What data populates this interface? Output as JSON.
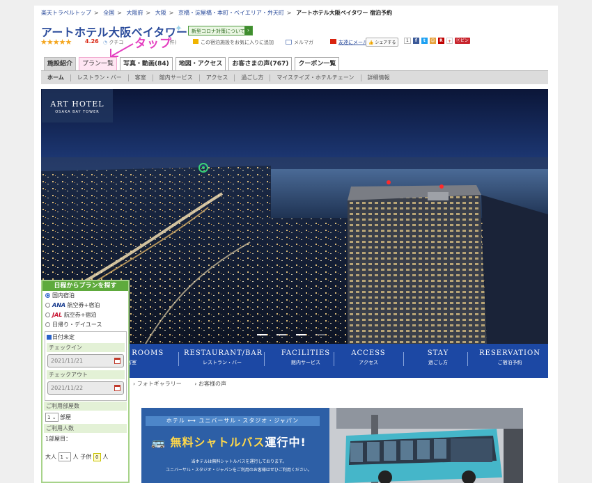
{
  "breadcrumb": [
    "楽天トラベルトップ",
    "全国",
    "大阪府",
    "大阪",
    "京橋・淀屋橋・本町・ベイエリア・弁天町",
    "アートホテル大阪ベイタワー 宿泊予約"
  ],
  "breadcrumb_sep": ">",
  "hotel": {
    "name": "アートホテル大阪ベイタワー",
    "covid_button": "新型コロナ対策について",
    "rating_stars": 4.26,
    "rating": "4.26",
    "kuchikomi": "クチコ",
    "kuchikomi_tail": "件)",
    "favorite": "この宿泊施設をお気に入りに追加",
    "mailmag": "メルマガ",
    "tell_friend": "友達にメール",
    "share": "シェアする",
    "share_count": "1",
    "pin": "ピン"
  },
  "annotation": {
    "text": "タップ",
    "color": "#e43ec0"
  },
  "tabs": [
    "施設紹介",
    "プラン一覧",
    "写真・動画(84)",
    "地図・アクセス",
    "お客さまの声(767)",
    "クーポン一覧"
  ],
  "subnav": [
    "ホーム",
    "レストラン・バー",
    "客室",
    "館内サービス",
    "アクセス",
    "過ごし方",
    "マイステイズ・ホテルチェーン",
    "詳細情報"
  ],
  "hero": {
    "logo_main": "ART HOTEL",
    "logo_sub": "OSAKA BAY TOWER"
  },
  "banner_nav": [
    {
      "en": "GUEST ROOMS",
      "jp": "客室"
    },
    {
      "en": "RESTAURANT/BAR",
      "jp": "レストラン・バー"
    },
    {
      "en": "FACILITIES",
      "jp": "館内サービス"
    },
    {
      "en": "ACCESS",
      "jp": "アクセス"
    },
    {
      "en": "STAY",
      "jp": "過ごし方"
    },
    {
      "en": "RESERVATION",
      "jp": "ご宿泊予約"
    }
  ],
  "links": [
    "フォトギャラリー",
    "お客様の声"
  ],
  "search": {
    "title": "日程からプランを探す",
    "options": [
      {
        "label": "国内宿泊",
        "brand": "",
        "selected": true
      },
      {
        "label": "航空券+宿泊",
        "brand": "ANA",
        "selected": false
      },
      {
        "label": "航空券+宿泊",
        "brand": "JAL",
        "selected": false
      },
      {
        "label": "日帰り・デイユース",
        "brand": "",
        "selected": false
      }
    ],
    "undecided": "日付未定",
    "checkin_label": "チェックイン",
    "checkin_value": "2021/11/21",
    "checkout_label": "チェックアウト",
    "checkout_value": "2021/11/22",
    "rooms_label": "ご利用部屋数",
    "rooms_value": "1",
    "rooms_unit": "部屋",
    "guests_label": "ご利用人数",
    "room1": "1部屋目：",
    "adult_label": "大人",
    "adult_value": "1",
    "person_unit": "人",
    "child_label": "子供",
    "child_value": "0",
    "child_unit": "人"
  },
  "shuttle": {
    "sub": "ホテル ⟷ ユニバーサル・スタジオ・ジャパン",
    "main1": "無料シャトルバス",
    "main2": "運行中!",
    "desc1": "当ホテルは無料シャトルバスを運行しております。",
    "desc2": "ユニバーサル・スタジオ・ジャパンをご利用のお客様はぜひご利用ください。"
  }
}
